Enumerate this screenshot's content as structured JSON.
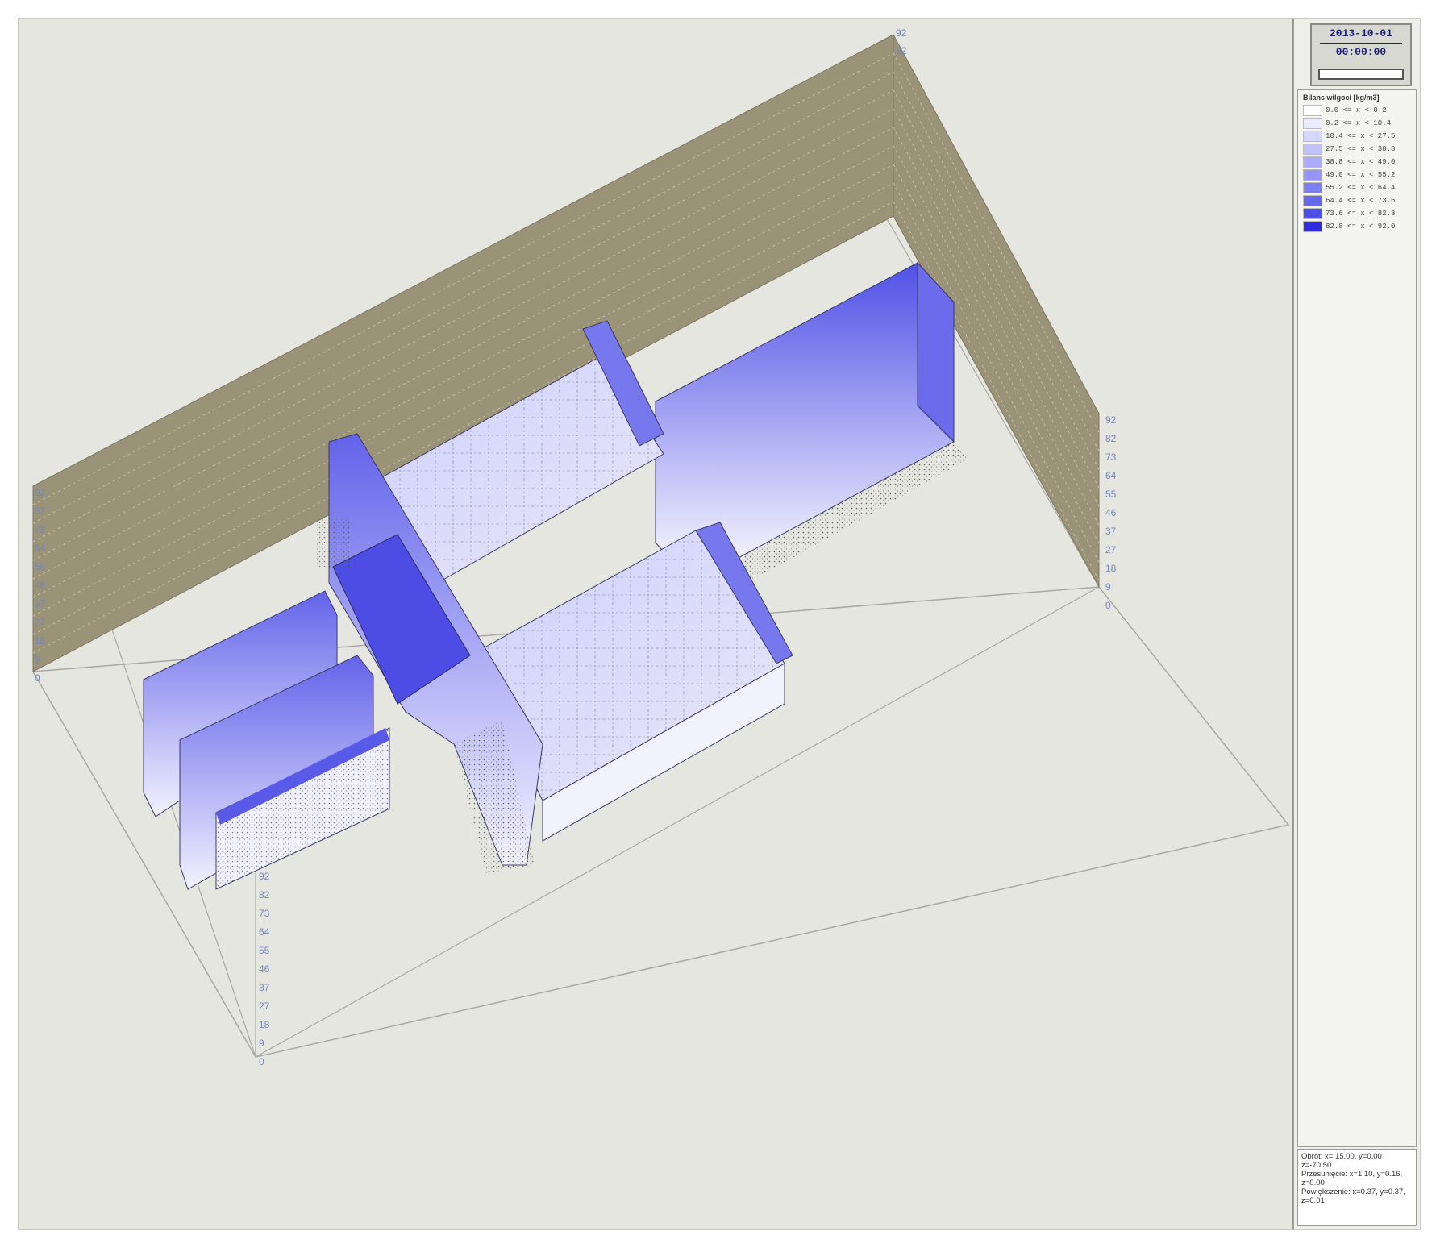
{
  "clock": {
    "date": "2013-10-01",
    "time": "00:00:00",
    "progress_fraction": 0.0
  },
  "legend": {
    "title": "Bilans wilgoci [kg/m3]",
    "items": [
      {
        "label": "0.0 <= x < 0.2",
        "color": "#ffffff"
      },
      {
        "label": "0.2 <= x < 10.4",
        "color": "#ececff"
      },
      {
        "label": "10.4 <= x < 27.5",
        "color": "#d6d6ff"
      },
      {
        "label": "27.5 <= x < 38.8",
        "color": "#c1c1ff"
      },
      {
        "label": "38.8 <= x < 49.0",
        "color": "#aaaaff"
      },
      {
        "label": "49.0 <= x < 55.2",
        "color": "#9595fb"
      },
      {
        "label": "55.2 <= x < 64.4",
        "color": "#7f7ff5"
      },
      {
        "label": "64.4 <= x < 73.6",
        "color": "#6868ef"
      },
      {
        "label": "73.6 <= x < 82.8",
        "color": "#4e4ee8"
      },
      {
        "label": "82.8 <= x < 92.0",
        "color": "#2e2ee0"
      }
    ]
  },
  "status": {
    "rotation": "Obrót: x= 15.00, y=0.00 z=-70.50",
    "translation": "Przesunięcie: x=1.10, y=0.16, z=0.00",
    "zoom": "Powiększenie: x=0.37, y=0.37, z=0.01"
  },
  "axes": {
    "left_wall_ticks": [
      "92",
      "82",
      "73",
      "64",
      "55",
      "46",
      "37",
      "27",
      "18",
      "9",
      "0"
    ],
    "right_wall_ticks": [
      "92",
      "82",
      "73",
      "64",
      "55",
      "46",
      "37",
      "27",
      "18",
      "9",
      "0"
    ],
    "vertical_axis_ticks": [
      "92",
      "82",
      "73",
      "64",
      "55",
      "46",
      "37",
      "27",
      "18",
      "9",
      "0"
    ],
    "top_corner_ticks": [
      "92",
      "92"
    ]
  },
  "colors": {
    "wall": "#9a9378",
    "floor": "#e6e6e0",
    "surface_dark": "#4b4be2",
    "surface_mid": "#8e8ef2",
    "surface_light": "#dcdcfa"
  }
}
